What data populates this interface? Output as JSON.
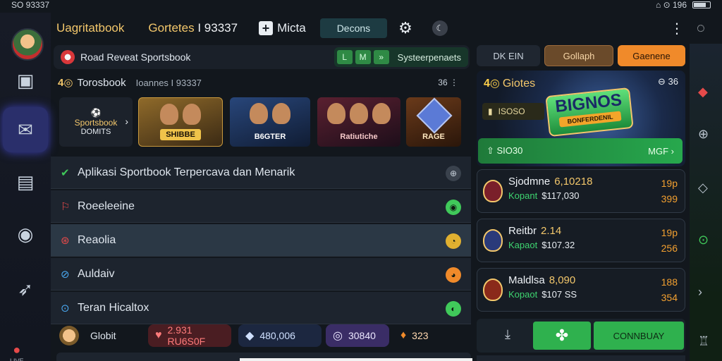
{
  "status_bar": {
    "time": "SO 93337",
    "right": "⌂ ⊙ 196"
  },
  "topbar": {
    "app_title": "Uagritatbook",
    "games_label": "Gortetes",
    "games_number": "93337",
    "menu_label": "Micta",
    "pill_label": "Decons"
  },
  "subheader": {
    "title": "Road Reveat Sportsbook",
    "controls": [
      "L",
      "M",
      "»"
    ],
    "controls_label": "Systeerpenaets"
  },
  "games": {
    "label": "Torosbook",
    "subtitle": "Ioannes I 93337",
    "right": "36",
    "sportsbook_card": {
      "title": "Sportsbook",
      "sub": "DOMITS"
    },
    "cards": [
      "SHIBBE",
      "B6GTER",
      "Ratiutiche",
      "RAGE"
    ]
  },
  "menu": {
    "items": [
      {
        "icon": "✔",
        "label": "Aplikasi Sportbook Terpercava dan Menarik",
        "trail": "⊕",
        "trail_color": "#6f7a86"
      },
      {
        "icon": "⚐",
        "label": "Roeeleeine",
        "trail": "◉",
        "trail_color": "#40c95a"
      },
      {
        "icon": "⊛",
        "label": "Reaolia",
        "trail": "◔",
        "trail_color": "#e0b030"
      },
      {
        "icon": "⊘",
        "label": "Auldaiv",
        "trail": "◕",
        "trail_color": "#f08a2a"
      },
      {
        "icon": "⊙",
        "label": "Teran Hicaltox",
        "trail": "◐",
        "trail_color": "#40c95a"
      }
    ]
  },
  "bottom_strip": {
    "name": "Globit",
    "chips": [
      {
        "icon": "♥",
        "value": "2.931 RU6S0F"
      },
      {
        "icon": "◆",
        "value": "480,006"
      },
      {
        "icon": "◎",
        "value": "30840"
      },
      {
        "icon": "♦",
        "value": "323"
      }
    ]
  },
  "right": {
    "tabs": [
      "DK EIN",
      "Gollaph",
      "Gaenene"
    ],
    "promo": {
      "title": "Giotes",
      "tools": "⊖ 36",
      "balance": "ISOSO",
      "logo_main": "BIGNOS",
      "logo_sub": "BONFERDENIL",
      "cta_left": "SIO30",
      "cta_right": "MGF"
    },
    "scores": [
      {
        "team": "Sjodmne",
        "value": "6,10218",
        "key": "Kopant",
        "odds": "$117,030",
        "side_top": "19p",
        "side_bottom": "399"
      },
      {
        "team": "Reitbr",
        "value": "2.14",
        "key": "Kapaot",
        "odds": "$107.32",
        "side_top": "19p",
        "side_bottom": "256"
      },
      {
        "team": "Maldlsa",
        "value": "8,090",
        "key": "Kopaot",
        "odds": "$107 SS",
        "side_top": "188",
        "side_bottom": "354"
      }
    ],
    "action_label": "CONNBUAY"
  }
}
